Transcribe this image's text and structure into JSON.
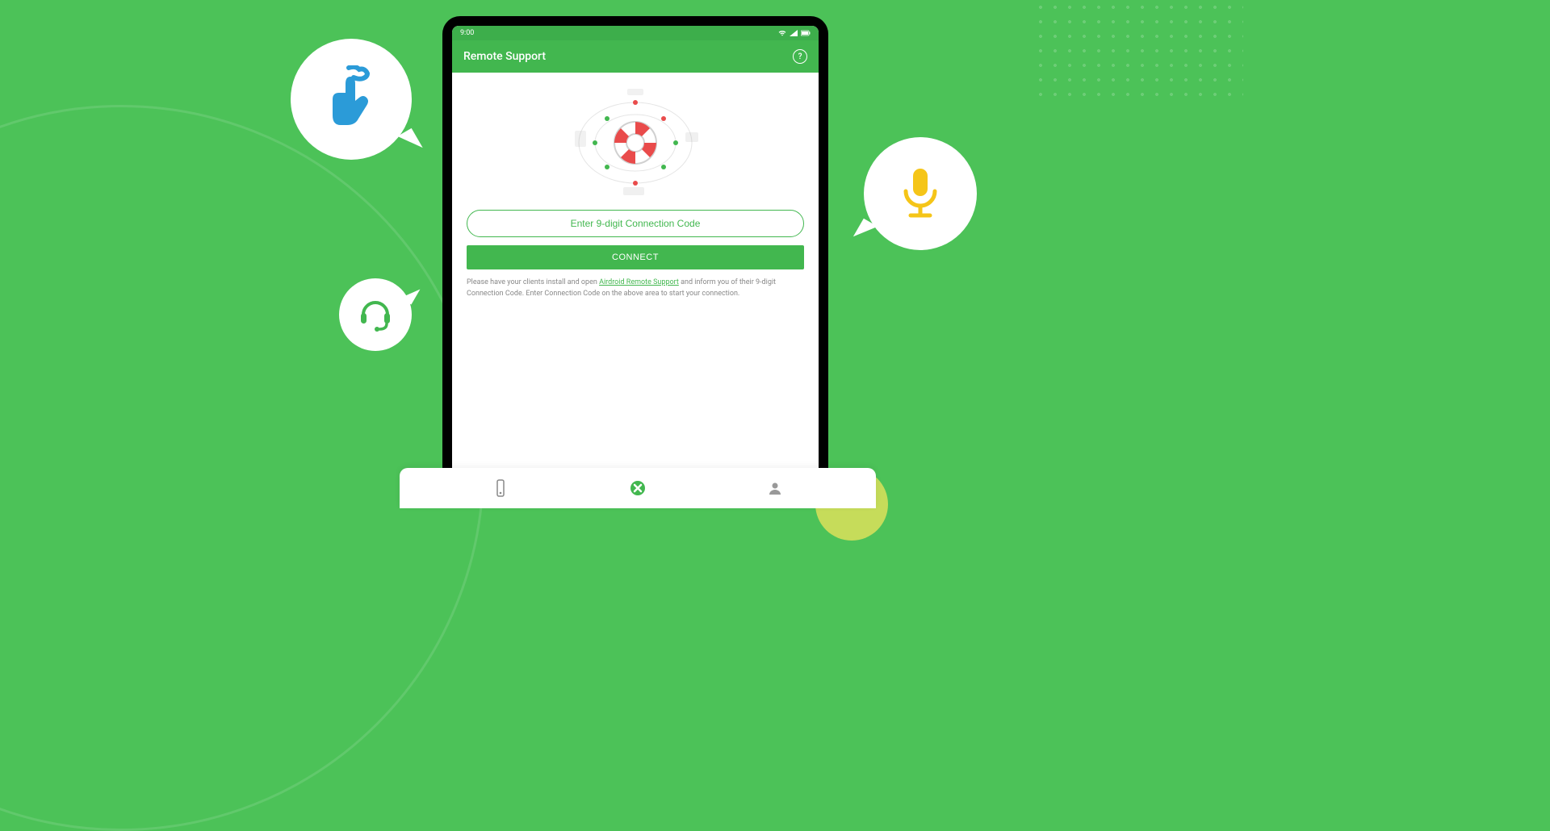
{
  "status_bar": {
    "time": "9:00"
  },
  "app": {
    "title": "Remote Support",
    "code_placeholder": "Enter 9-digit Connection Code",
    "connect_label": "CONNECT",
    "instruction_prefix": "Please have your clients install and open ",
    "instruction_link": "Airdroid Remote Support",
    "instruction_suffix": " and inform you of their 9-digit Connection Code. Enter Connection Code on the above area to start your connection."
  },
  "colors": {
    "background": "#4CC258",
    "primary": "#42B74F",
    "touch_icon": "#2B9BD8",
    "headset_icon": "#42B74F",
    "mic_icon": "#F5C518"
  }
}
